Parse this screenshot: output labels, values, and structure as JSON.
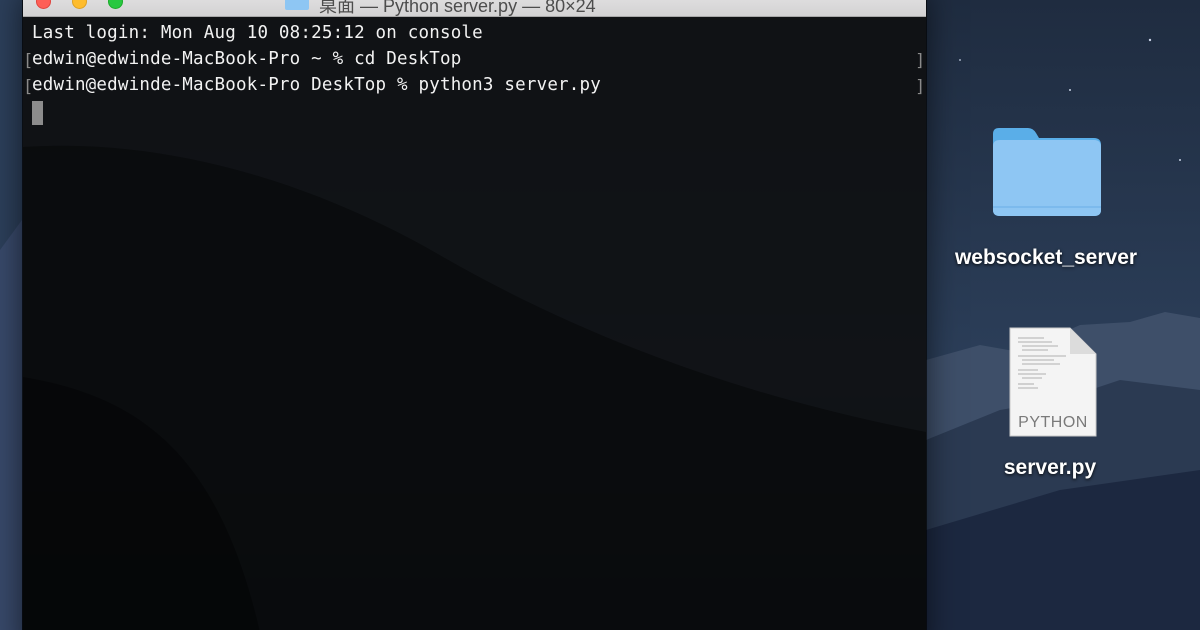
{
  "window": {
    "title": "桌面 — Python server.py — 80×24"
  },
  "terminal": {
    "lines": [
      "Last login: Mon Aug 10 08:25:12 on console",
      "edwin@edwinde-MacBook-Pro ~ % cd DeskTop",
      "edwin@edwinde-MacBook-Pro DeskTop % python3 server.py"
    ]
  },
  "desktop": {
    "folder": {
      "label": "websocket_server",
      "icon": "folder-icon"
    },
    "file": {
      "label": "server.py",
      "badge": "PYTHON",
      "icon": "python-file-icon"
    }
  },
  "colors": {
    "close": "#fe5f57",
    "minimize": "#febc2e",
    "maximize": "#28c840",
    "folder": "#8ec6f3"
  }
}
